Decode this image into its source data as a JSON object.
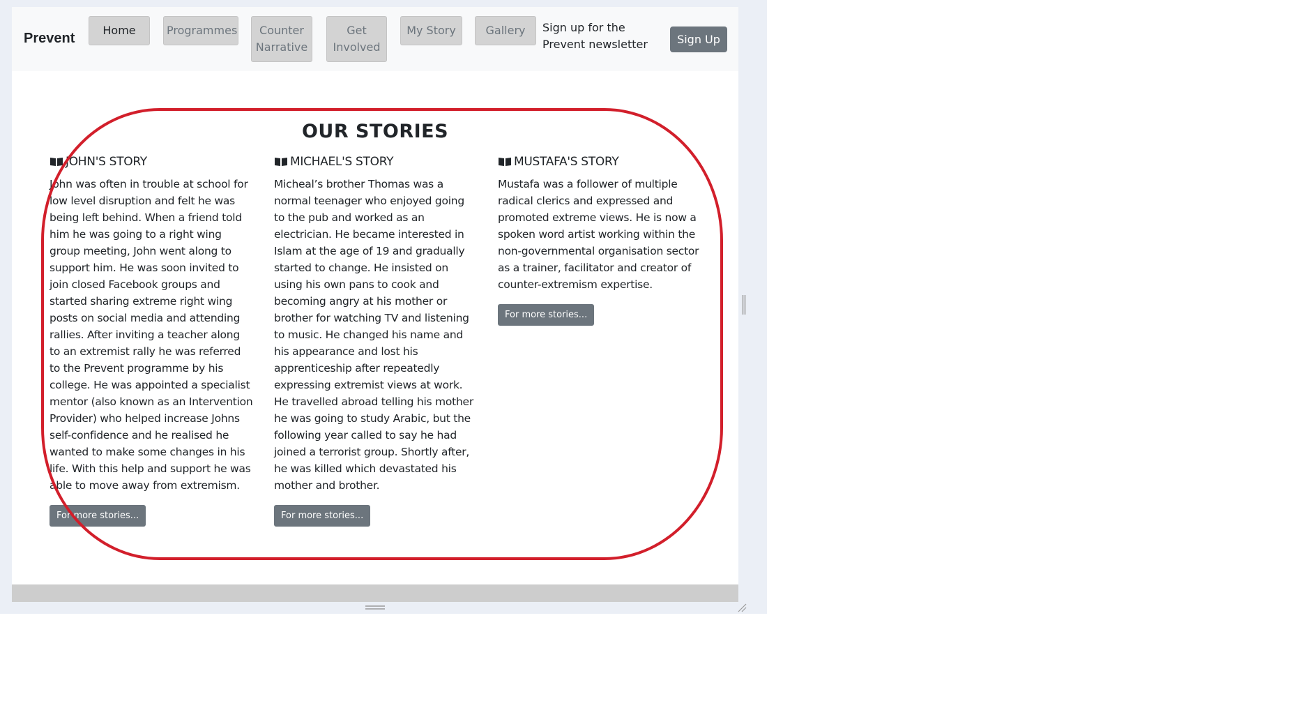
{
  "navbar": {
    "brand": "Prevent",
    "items": [
      {
        "label": "Home",
        "active": true
      },
      {
        "label": "Programmes",
        "active": false
      },
      {
        "label": "Counter Narrative",
        "active": false
      },
      {
        "label": "Get Involved",
        "active": false
      },
      {
        "label": "My Story",
        "active": false
      },
      {
        "label": "Gallery",
        "active": false
      }
    ],
    "newsletter_text": "Sign up for the Prevent newsletter",
    "signup_label": "Sign Up"
  },
  "main": {
    "title": "OUR STORIES",
    "stories": [
      {
        "heading": "JOHN'S STORY",
        "icon": "book-open-icon",
        "body": "John was often in trouble at school for low level disruption and felt he was being left behind. When a friend told him he was going to a right wing group meeting, John went along to support him. He was soon invited to join closed Facebook groups and started sharing extreme right wing posts on social media and attending rallies. After inviting a teacher along to an extremist rally he was referred to the Prevent programme by his college. He was appointed a specialist mentor (also known as an Intervention Provider) who helped increase Johns self-confidence and he realised he wanted to make some changes in his life. With this help and support he was able to move away from extremism.",
        "button_label": "For more stories..."
      },
      {
        "heading": "MICHAEL'S STORY",
        "icon": "book-open-icon",
        "body": "Micheal’s brother Thomas was a normal teenager who enjoyed going to the pub and worked as an electrician. He became interested in Islam at the age of 19 and gradually started to change. He insisted on using his own pans to cook and becoming angry at his mother or brother for watching TV and listening to music. He changed his name and his appearance and lost his apprenticeship after repeatedly expressing extremist views at work. He travelled abroad telling his mother he was going to study Arabic, but the following year called to say he had joined a terrorist group. Shortly after, he was killed which devastated his mother and brother.",
        "button_label": "For more stories..."
      },
      {
        "heading": "MUSTAFA'S STORY",
        "icon": "book-open-icon",
        "body": "Mustafa was a follower of multiple radical clerics and expressed and promoted extreme views. He is now a spoken word artist working within the non-governmental organisation sector as a trainer, facilitator and creator of counter-extremism expertise.",
        "button_label": "For more stories..."
      }
    ]
  },
  "colors": {
    "highlight_ring": "#d21f2b",
    "secondary_button": "#6c757d",
    "nav_button_bg": "#d3d3d3",
    "navbar_bg": "#f8f9fa",
    "footer_bar": "#cdcdcd",
    "backdrop": "#ebeff6"
  }
}
